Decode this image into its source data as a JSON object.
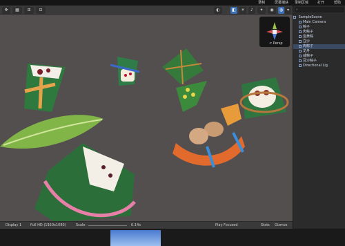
{
  "menubar": {
    "items": [
      "录制",
      "屏幕捕获",
      "录制区域",
      "打开",
      "帮助"
    ]
  },
  "toolbar": {
    "persp_label": "< Persp"
  },
  "statusbar": {
    "display": "Display 1",
    "resolution": "Full HD (1920x1080)",
    "scale_label": "Scale",
    "scale_value": "0.14x",
    "play_mode": "Play Focused",
    "stats": "Stats",
    "gizmos": "Gizmos"
  },
  "hierarchy": {
    "scene_name": "SampleScene",
    "items": [
      "Main Camera",
      "粽子",
      "肉粽子",
      "蛋黄粽",
      "豆沙",
      "肉粽子",
      "龙舟",
      "咸粽子",
      "豆沙粽子",
      "Directional Lig"
    ],
    "selected_index": 5
  },
  "colors": {
    "viewport_bg": "#544f4f",
    "accent": "#3d6fb6",
    "panel_bg": "#2b2b2b"
  }
}
